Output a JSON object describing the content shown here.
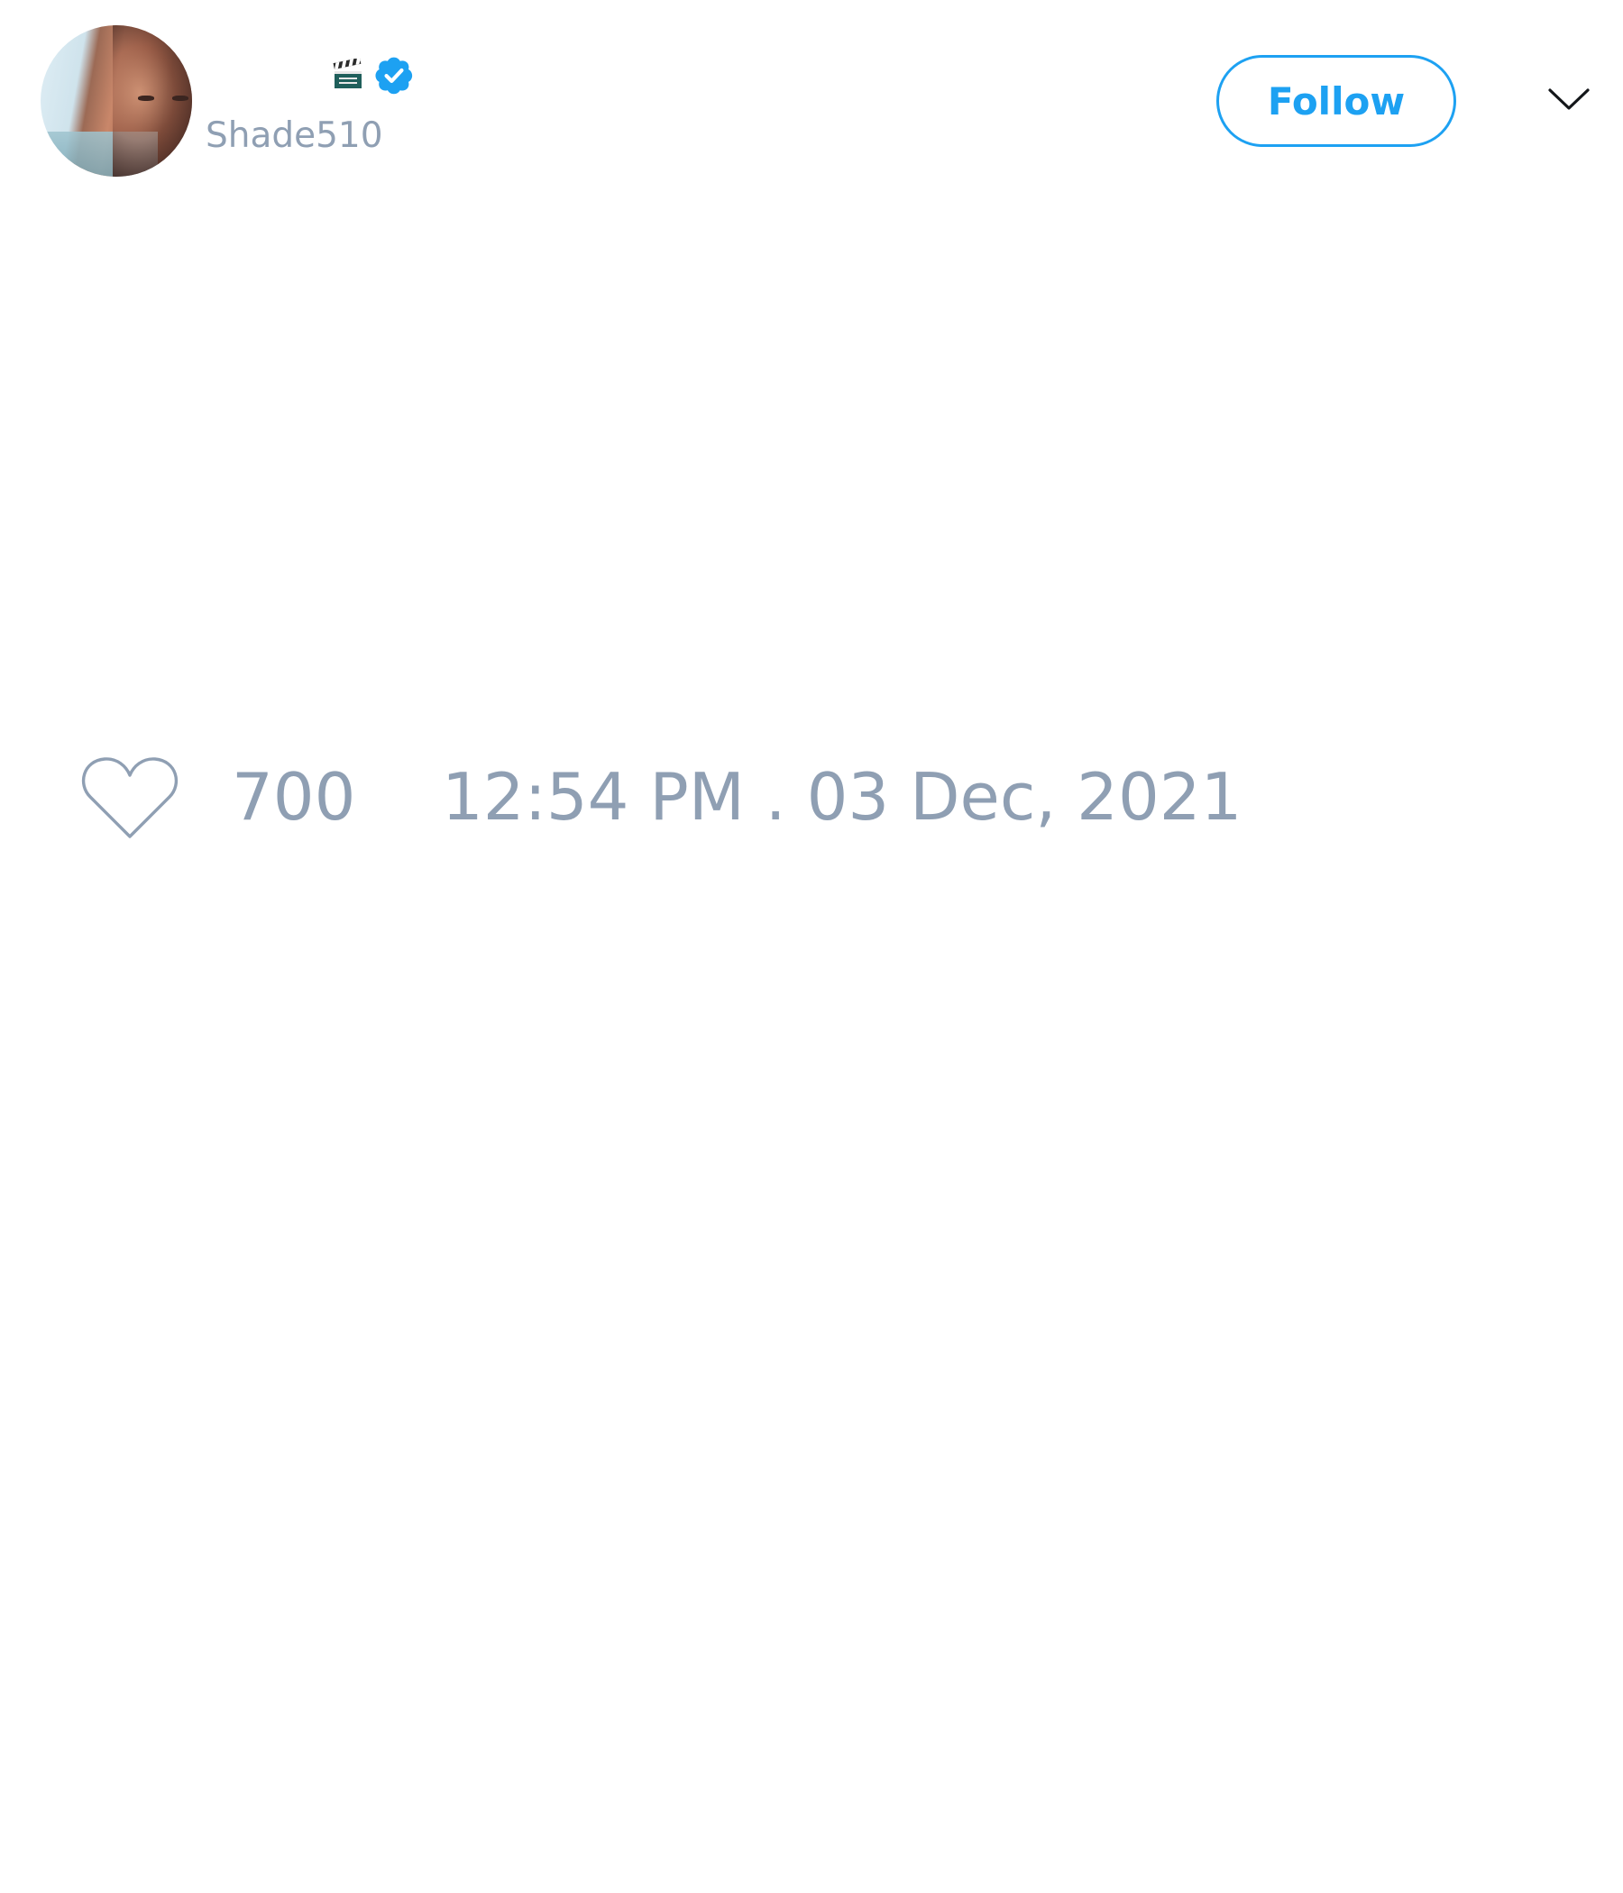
{
  "author": {
    "display_name": "",
    "handle": "Shade510",
    "emoji_icon": "clapper-board-icon",
    "verified_icon": "verified-badge-icon",
    "verified_color": "#1da1f2"
  },
  "actions": {
    "follow_label": "Follow",
    "menu_icon": "chevron-down-icon",
    "accent_color": "#1da1f2"
  },
  "stats": {
    "like_icon": "heart-icon",
    "like_count": "700",
    "timestamp": "12:54 PM . 03 Dec, 2021",
    "muted_color": "#8f9fb3"
  }
}
